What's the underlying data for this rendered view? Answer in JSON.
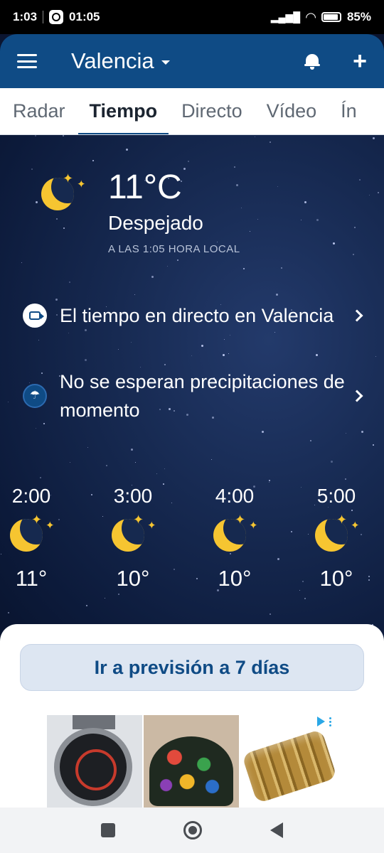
{
  "status": {
    "time": "1:03",
    "app_time": "01:05",
    "battery": "85%"
  },
  "header": {
    "city": "Valencia",
    "icons": [
      "menu-icon",
      "bell-icon",
      "plus-icon"
    ]
  },
  "tabs": [
    {
      "label": "Radar"
    },
    {
      "label": "Tiempo",
      "active": true
    },
    {
      "label": "Directo"
    },
    {
      "label": "Vídeo"
    },
    {
      "label": "Ín"
    }
  ],
  "current": {
    "temperature": "11°C",
    "condition": "Despejado",
    "local_time": "A LAS 1:05 HORA LOCAL",
    "icon": "moon-stars-icon"
  },
  "links": [
    {
      "text": "El tiempo en directo en Valencia",
      "icon": "video-camera-icon"
    },
    {
      "text": "No se esperan precipitaciones de momento",
      "icon": "umbrella-icon"
    }
  ],
  "hourly": [
    {
      "time": "2:00",
      "temp": "11°"
    },
    {
      "time": "3:00",
      "temp": "10°"
    },
    {
      "time": "4:00",
      "temp": "10°"
    },
    {
      "time": "5:00",
      "temp": "10°"
    }
  ],
  "cta": {
    "label": "Ir a previsión a 7 días"
  },
  "colors": {
    "brand": "#0f4b85",
    "sky": "#172a52",
    "moon": "#f6c531"
  }
}
